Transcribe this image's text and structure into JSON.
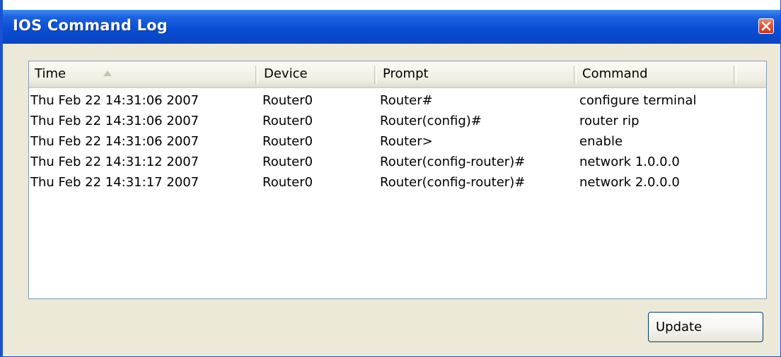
{
  "window": {
    "title": "IOS Command Log"
  },
  "columns": [
    "Time",
    "Device",
    "Prompt",
    "Command"
  ],
  "sort": {
    "column": "Time",
    "direction": "ascending"
  },
  "rows": [
    {
      "time": "Thu Feb 22 14:31:06 2007",
      "device": "Router0",
      "prompt": "Router#",
      "command": "configure terminal"
    },
    {
      "time": "Thu Feb 22 14:31:06 2007",
      "device": "Router0",
      "prompt": "Router(config)#",
      "command": "router rip"
    },
    {
      "time": "Thu Feb 22 14:31:06 2007",
      "device": "Router0",
      "prompt": "Router>",
      "command": "enable"
    },
    {
      "time": "Thu Feb 22 14:31:12 2007",
      "device": "Router0",
      "prompt": "Router(config-router)#",
      "command": "network 1.0.0.0"
    },
    {
      "time": "Thu Feb 22 14:31:17 2007",
      "device": "Router0",
      "prompt": "Router(config-router)#",
      "command": "network 2.0.0.0"
    }
  ],
  "buttons": {
    "update_label": "Update"
  },
  "colors": {
    "titlebar": "#0a4ed6",
    "close": "#e2553a",
    "window_bg": "#ece9d8",
    "table_border": "#7f9db9"
  },
  "icons": {
    "close": "close-icon",
    "sort": "sort-ascending-icon"
  }
}
